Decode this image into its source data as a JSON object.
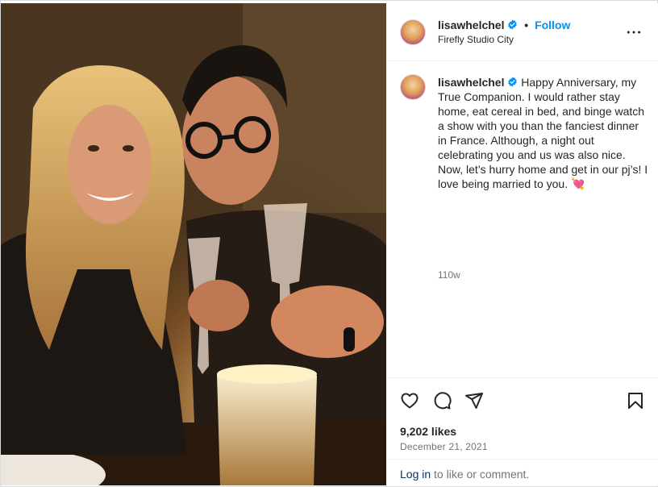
{
  "post": {
    "username": "lisawhelchel",
    "separator": "•",
    "follow_label": "Follow",
    "location": "Firefly Studio City",
    "more_icon": "more-horizontal-icon",
    "caption": "Happy Anniversary, my True Companion. I would rather stay home, eat cereal in bed, and binge watch a show with you than the fanciest dinner in France. Although, a night out celebrating you and us was also nice. Now, let’s hurry home and get in our pj’s! I love being married to you. 💘",
    "caption_age": "110w",
    "likes": "9,202 likes",
    "date": "December 21, 2021",
    "login_link": "Log in",
    "login_suffix": " to like or comment."
  },
  "icons": {
    "like": "heart-icon",
    "comment": "comment-icon",
    "share": "paper-plane-icon",
    "save": "bookmark-icon",
    "verified": "verified-badge-icon"
  },
  "colors": {
    "accent": "#0095f6",
    "link": "#00376b",
    "muted": "#737373",
    "text": "#262626",
    "border": "#dbdbdb"
  }
}
